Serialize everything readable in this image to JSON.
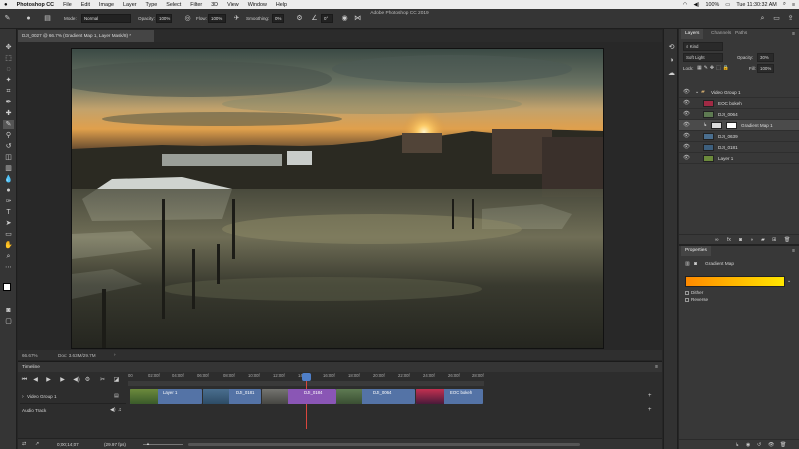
{
  "menubar": {
    "app": "Photoshop CC",
    "items": [
      "File",
      "Edit",
      "Image",
      "Layer",
      "Type",
      "Select",
      "Filter",
      "3D",
      "View",
      "Window",
      "Help"
    ],
    "battery": "100%",
    "clock": "Tue 11:30:32 AM"
  },
  "window_title": "Adobe Photoshop CC 2019",
  "options": {
    "mode_label": "Mode:",
    "mode_value": "Normal",
    "opacity_label": "Opacity:",
    "opacity_value": "100%",
    "flow_label": "Flow:",
    "flow_value": "100%",
    "smoothing_label": "Smoothing:",
    "smoothing_value": "0%",
    "angle_value": "0°"
  },
  "document_tab": "DJI_0027 @ 66.7% (Gradient Map 1, Layer Mask/8) *",
  "status": {
    "zoom": "66.67%",
    "doc": "Doc: 3.63M/29.7M"
  },
  "timeline": {
    "tab": "Timeline",
    "ticks": [
      "00",
      "02:00f",
      "04:00f",
      "06:00f",
      "08:00f",
      "10:00f",
      "12:00f",
      "14:00f",
      "16:00f",
      "18:00f",
      "20:00f",
      "22:00f",
      "24:00f",
      "26:00f",
      "28:00f"
    ],
    "video_group": "Video Group 1",
    "audio_track": "Audio Track",
    "clips": [
      "Layer 1",
      "DJI_0181",
      "DJI_0184",
      "DJI_0064",
      "EOC bokeh"
    ],
    "timecode": "0;00;14;07",
    "fps": "(29.97 fps)"
  },
  "layers_panel": {
    "tabs": [
      "Layers",
      "Channels",
      "Paths"
    ],
    "kind": "Kind",
    "blend_mode": "Soft Light",
    "opacity_label": "Opacity:",
    "opacity": "30%",
    "lock_label": "Lock:",
    "fill_label": "Fill:",
    "fill": "100%",
    "layers": [
      {
        "name": "Video Group 1",
        "type": "group"
      },
      {
        "name": "EOC bokeh",
        "type": "video"
      },
      {
        "name": "DJI_0064",
        "type": "video"
      },
      {
        "name": "Gradient Map 1",
        "type": "adjustment"
      },
      {
        "name": "DJI_0639",
        "type": "video"
      },
      {
        "name": "DJI_0181",
        "type": "video"
      },
      {
        "name": "Layer 1",
        "type": "video"
      }
    ]
  },
  "properties": {
    "tab": "Properties",
    "title": "Gradient Map",
    "dither": "Dither",
    "reverse": "Reverse",
    "gradient_start": "#ff8a00",
    "gradient_end": "#ffe600"
  }
}
